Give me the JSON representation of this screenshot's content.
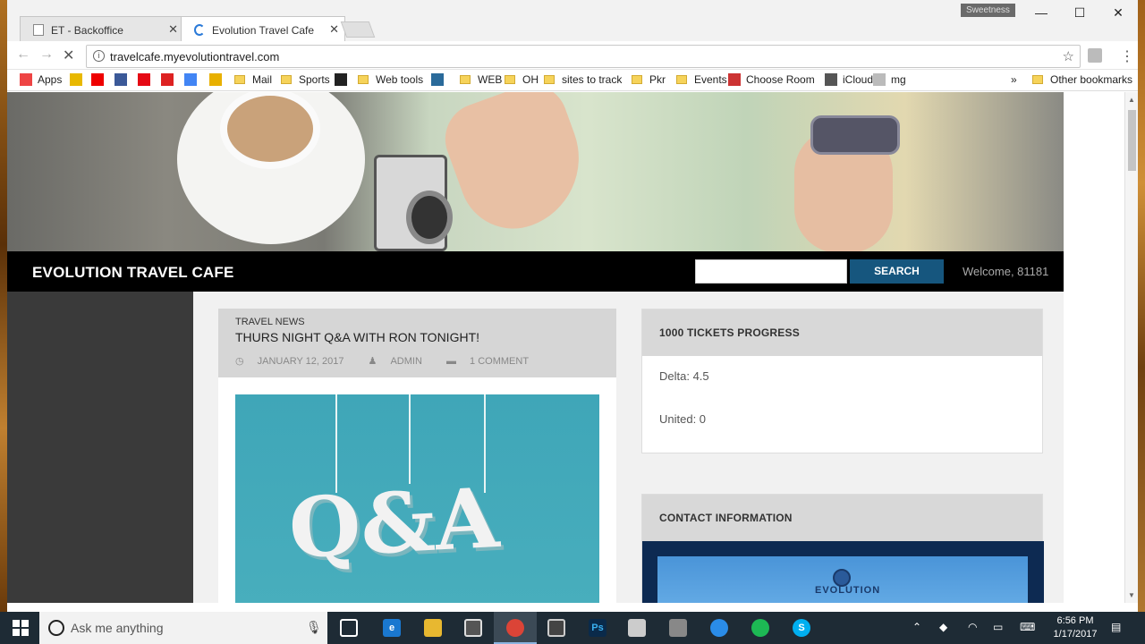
{
  "browser": {
    "tabs": [
      {
        "title": "ET - Backoffice",
        "close": "✕"
      },
      {
        "title": "Evolution Travel Cafe",
        "close": "✕"
      }
    ],
    "profile_label": "Sweetness",
    "url": "travelcafe.myevolutiontravel.com",
    "window_controls": {
      "minimize": "—",
      "maximize": "☐",
      "close": "✕"
    },
    "bookmarks": [
      {
        "label": "Apps",
        "icon": "apps-grid-icon"
      },
      {
        "label": "",
        "icon": "imdb-icon"
      },
      {
        "label": "",
        "icon": "youtube-icon"
      },
      {
        "label": "",
        "icon": "facebook-icon"
      },
      {
        "label": "",
        "icon": "netflix-icon"
      },
      {
        "label": "",
        "icon": "tomato-icon"
      },
      {
        "label": "",
        "icon": "google-icon"
      },
      {
        "label": "",
        "icon": "pocket-icon"
      },
      {
        "label": "Mail",
        "icon": "folder-icon"
      },
      {
        "label": "Sports",
        "icon": "folder-icon"
      },
      {
        "label": "",
        "icon": "amazon-icon"
      },
      {
        "label": "Web tools",
        "icon": "folder-icon"
      },
      {
        "label": "",
        "icon": "gt-icon"
      },
      {
        "label": "WEB",
        "icon": "folder-icon"
      },
      {
        "label": "OH",
        "icon": "folder-icon"
      },
      {
        "label": "sites to track",
        "icon": "folder-icon"
      },
      {
        "label": "Pkr",
        "icon": "folder-icon"
      },
      {
        "label": "Events",
        "icon": "folder-icon"
      },
      {
        "label": "Choose Room",
        "icon": "hotel-icon"
      },
      {
        "label": "iCloud",
        "icon": "apple-icon"
      },
      {
        "label": "mg",
        "icon": "mg-icon"
      }
    ],
    "overflow": "»",
    "other_bookmarks": "Other bookmarks"
  },
  "site": {
    "title": "EVOLUTION TRAVEL CAFE",
    "search_button": "SEARCH",
    "search_value": "",
    "welcome": "Welcome, 81181"
  },
  "post": {
    "category": "TRAVEL NEWS",
    "title": "THURS NIGHT Q&A WITH RON TONIGHT!",
    "date": "JANUARY 12, 2017",
    "author": "ADMIN",
    "comments": "1 COMMENT",
    "image_text": "Q&A"
  },
  "widgets": {
    "tickets": {
      "title": "1000 TICKETS PROGRESS",
      "rows": [
        "Delta: 4.5",
        "United: 0"
      ]
    },
    "contact": {
      "title": "CONTACT INFORMATION",
      "logo_text": "EVOLUTION"
    }
  },
  "taskbar": {
    "search_placeholder": "Ask me anything",
    "time": "6:56 PM",
    "date": "1/17/2017"
  }
}
